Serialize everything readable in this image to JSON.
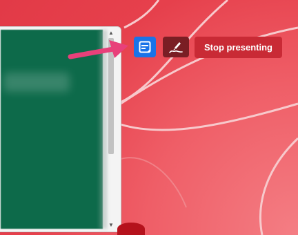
{
  "toolbar": {
    "stop_presenting_label": "Stop presenting",
    "speaker_notes_icon": "speaker-notes-icon",
    "annotate_icon": "pen-annotate-icon"
  },
  "preview": {
    "scroll_up_glyph": "▲",
    "scroll_down_glyph": "▼"
  },
  "colors": {
    "background": "#e84a55",
    "slide": "#0d6a4a",
    "notes_button": "#1a73e8",
    "pen_button": "#7a1e24",
    "stop_button": "#c92a35",
    "arrow": "#e8407a"
  }
}
